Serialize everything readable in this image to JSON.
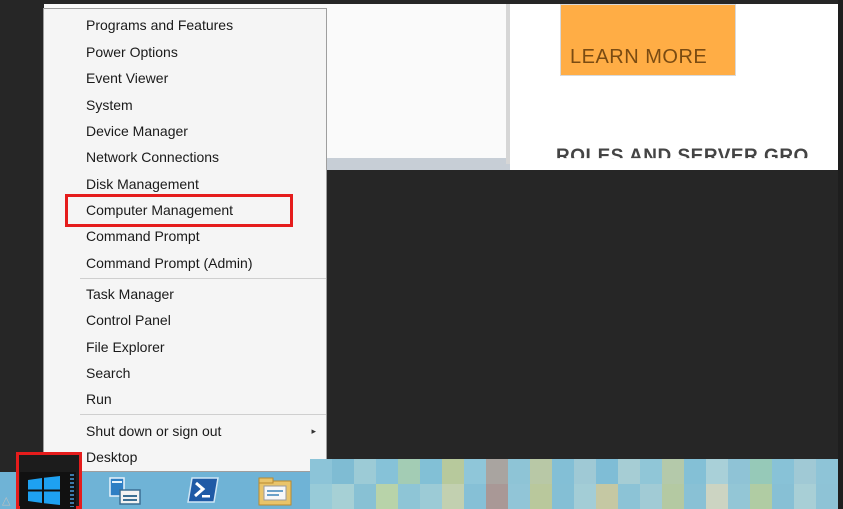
{
  "background": {
    "learn_more": "LEARN MORE",
    "roles_heading": "ROLES AND SERVER GRO"
  },
  "menu": {
    "group1": [
      {
        "label": "Programs and Features"
      },
      {
        "label": "Power Options"
      },
      {
        "label": "Event Viewer"
      },
      {
        "label": "System"
      },
      {
        "label": "Device Manager"
      },
      {
        "label": "Network Connections"
      },
      {
        "label": "Disk Management"
      },
      {
        "label": "Computer Management"
      },
      {
        "label": "Command Prompt"
      },
      {
        "label": "Command Prompt (Admin)"
      }
    ],
    "group2": [
      {
        "label": "Task Manager"
      },
      {
        "label": "Control Panel"
      },
      {
        "label": "File Explorer"
      },
      {
        "label": "Search"
      },
      {
        "label": "Run"
      }
    ],
    "group3": [
      {
        "label": "Shut down or sign out",
        "submenu_arrow": "▸"
      },
      {
        "label": "Desktop"
      }
    ],
    "highlighted_item": "Computer Management"
  },
  "taskbar": {
    "icons": [
      "start-windows-icon",
      "server-manager-icon",
      "powershell-icon",
      "file-explorer-icon"
    ]
  },
  "colors": {
    "highlight_border": "#e51c1c",
    "taskbar": "#6fb3d6",
    "learn_more_bg": "#ffad45"
  }
}
